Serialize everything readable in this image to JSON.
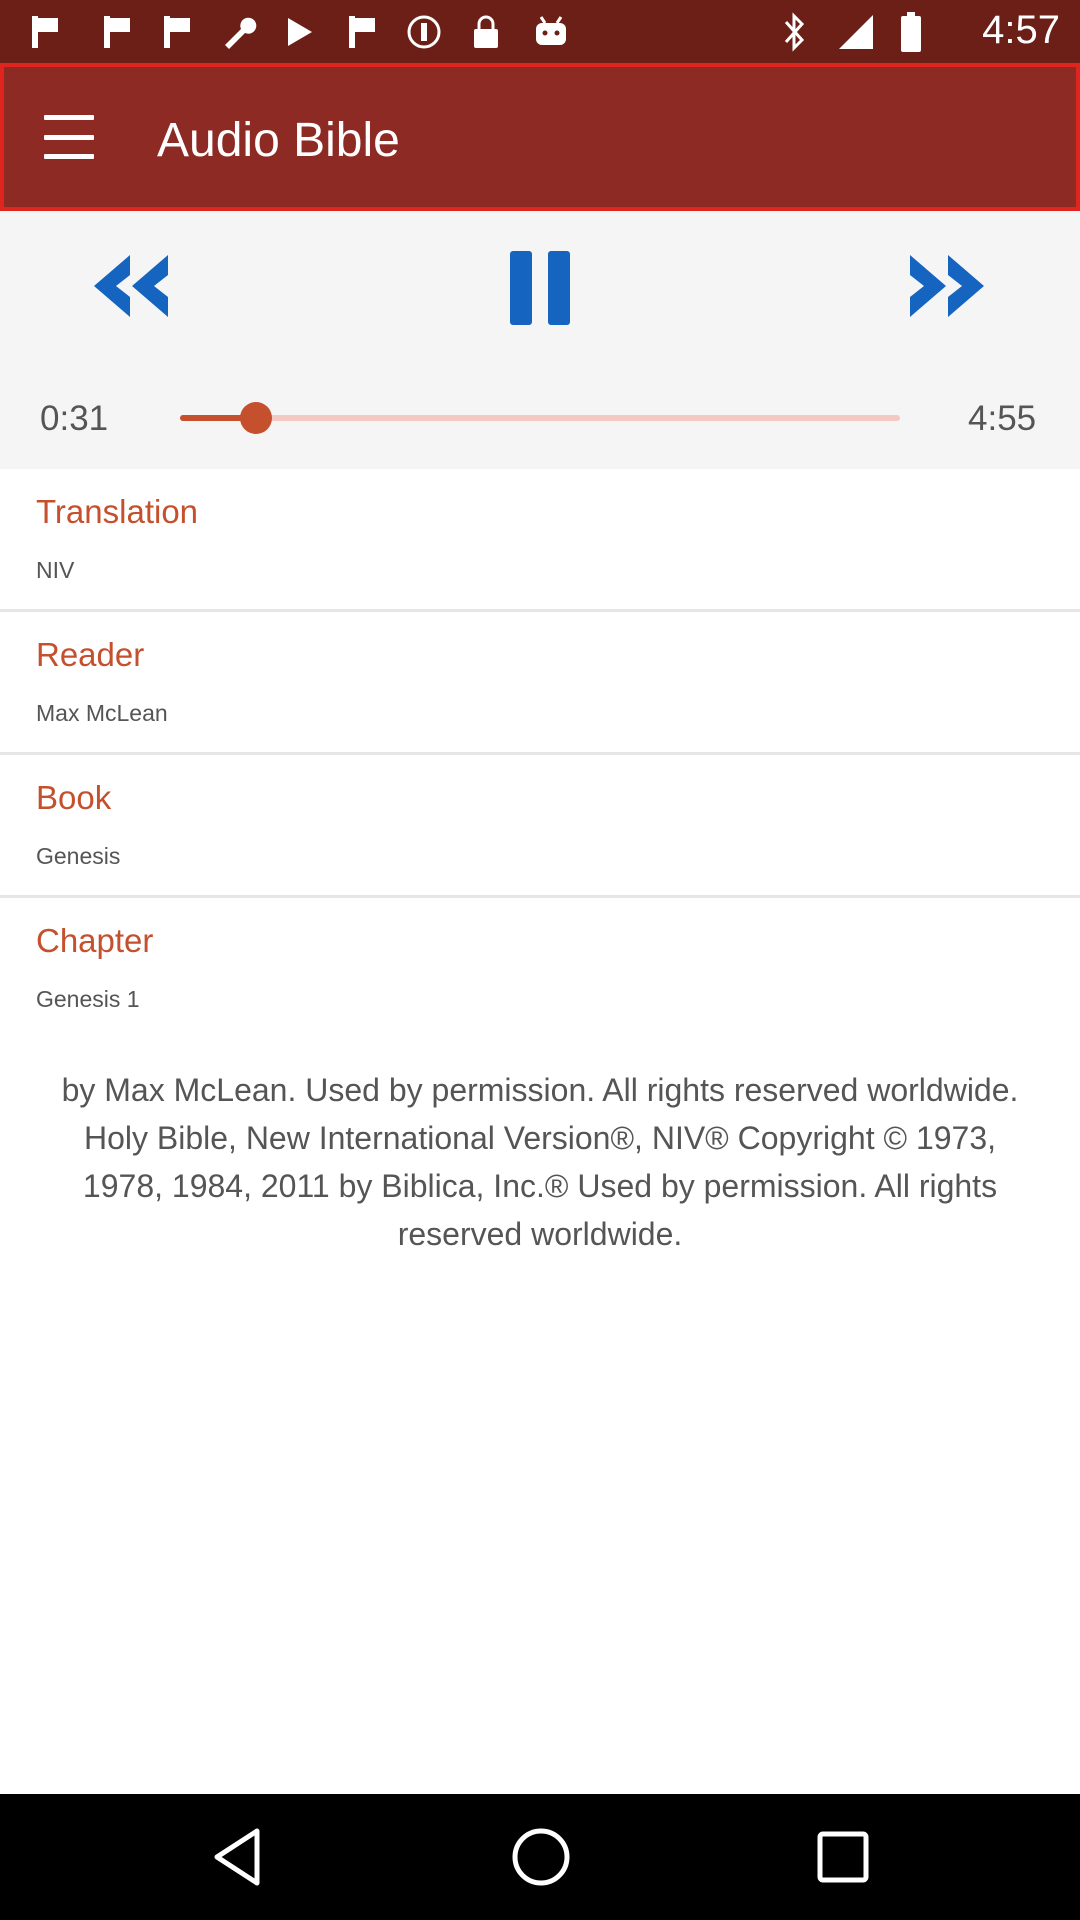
{
  "status_bar": {
    "time": "4:57",
    "left_icons": [
      "flag-icon",
      "flag-icon",
      "flag-icon",
      "wrench-icon",
      "play-store-icon",
      "flag-icon",
      "info-icon",
      "lock-icon",
      "android-icon"
    ],
    "right_icons": [
      "bluetooth-icon",
      "signal-icon",
      "battery-icon"
    ]
  },
  "toolbar": {
    "title": "Audio Bible",
    "menu_icon": "hamburger-menu-icon"
  },
  "player": {
    "rewind_icon": "rewind-icon",
    "pause_icon": "pause-icon",
    "forward_icon": "fast-forward-icon",
    "elapsed": "0:31",
    "duration": "4:55",
    "progress": 0.105
  },
  "info": [
    {
      "label": "Translation",
      "value": "NIV"
    },
    {
      "label": "Reader",
      "value": "Max McLean"
    },
    {
      "label": "Book",
      "value": "Genesis"
    },
    {
      "label": "Chapter",
      "value": "Genesis 1"
    }
  ],
  "copyright": "by Max McLean. Used by permission. All rights reserved worldwide. Holy Bible, New International Version®, NIV® Copyright © 1973, 1978, 1984, 2011 by Biblica, Inc.® Used by permission. All rights reserved worldwide.",
  "colors": {
    "status_bar": "#6b1f17",
    "toolbar": "#8e2a24",
    "accent": "#c4502e",
    "controls": "#1565c0",
    "panel": "#f5f5f5"
  },
  "nav_bar": [
    "back-icon",
    "home-icon",
    "recents-icon"
  ]
}
